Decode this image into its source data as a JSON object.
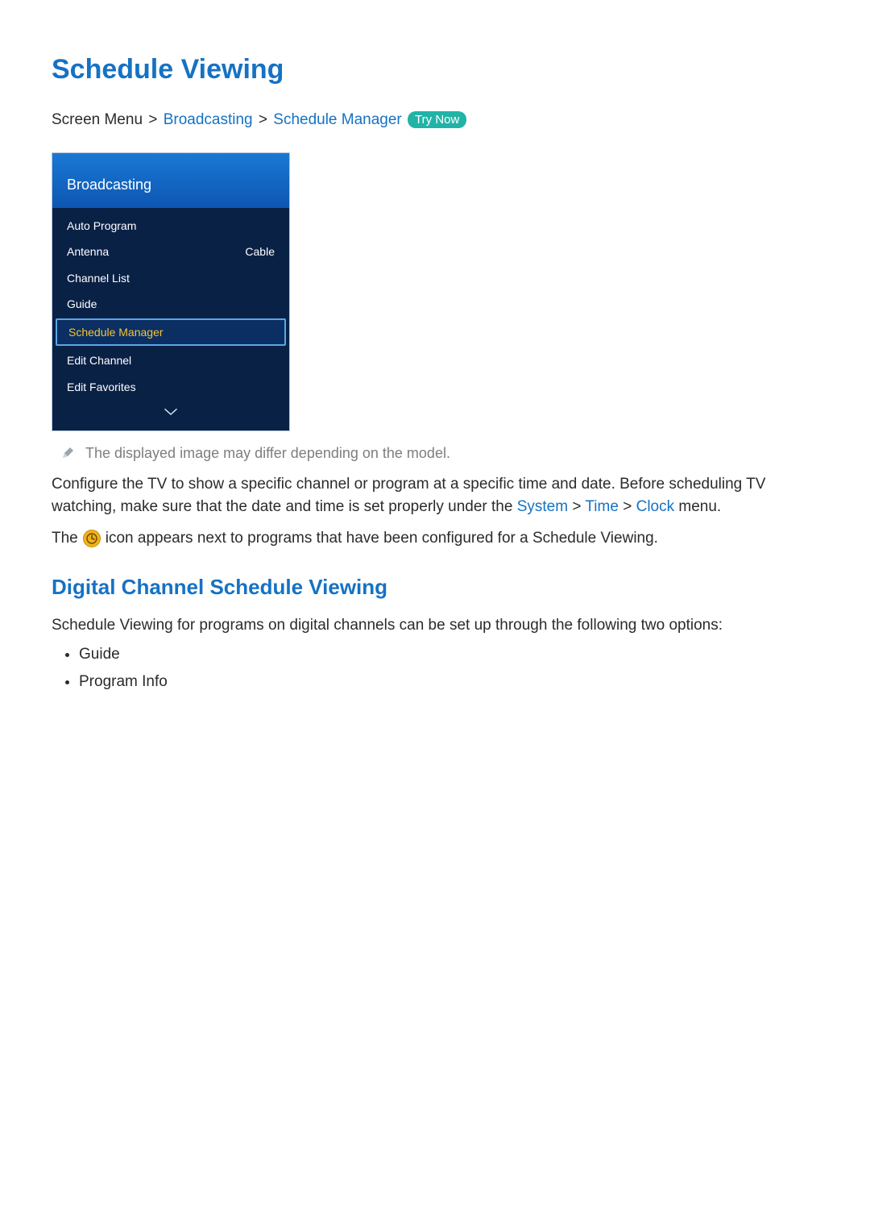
{
  "title": "Schedule Viewing",
  "crumbs": {
    "lead": "Screen Menu",
    "a": "Broadcasting",
    "b": "Schedule Manager",
    "try_now": "Try Now"
  },
  "menu": {
    "header": "Broadcasting",
    "items": [
      {
        "label": "Auto Program",
        "value": "",
        "selected": false
      },
      {
        "label": "Antenna",
        "value": "Cable",
        "selected": false
      },
      {
        "label": "Channel List",
        "value": "",
        "selected": false
      },
      {
        "label": "Guide",
        "value": "",
        "selected": false
      },
      {
        "label": "Schedule Manager",
        "value": "",
        "selected": true
      },
      {
        "label": "Edit Channel",
        "value": "",
        "selected": false
      },
      {
        "label": "Edit Favorites",
        "value": "",
        "selected": false
      }
    ]
  },
  "note": "The displayed image may differ depending on the model.",
  "body": {
    "p1a": "Configure the TV to show a specific channel or program at a specific time and date. Before scheduling TV watching, make sure that the date and time is set properly under the ",
    "system": "System",
    "time": "Time",
    "clock": "Clock",
    "p1b": " menu.",
    "p2a": "The ",
    "p2b": " icon appears next to programs that have been configured for a Schedule Viewing."
  },
  "subhead": "Digital Channel Schedule Viewing",
  "p3": "Schedule Viewing for programs on digital channels can be set up through the following two options:",
  "options": [
    "Guide",
    "Program Info"
  ]
}
